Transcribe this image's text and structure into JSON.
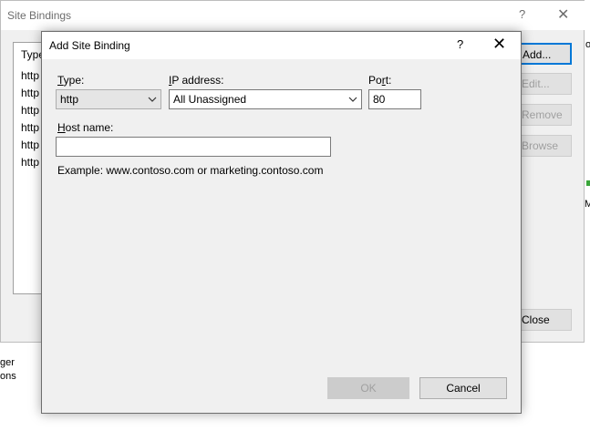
{
  "background_window": {
    "title": "Site Bindings",
    "help_glyph": "?",
    "close_glyph": "✕",
    "list_header": "Type",
    "list_items": [
      "http",
      "http",
      "http",
      "http",
      "http",
      "http"
    ],
    "buttons": {
      "add": "Add...",
      "edit": "Edit...",
      "remove": "Remove",
      "browse": "Browse",
      "close": "Close"
    },
    "side_text_1": "ger",
    "side_text_2": "ons",
    "right_edge_text_1": "o",
    "right_edge_text_2": "M"
  },
  "dialog": {
    "title": "Add Site Binding",
    "help_glyph": "?",
    "close_glyph": "✕",
    "type": {
      "label_accel": "T",
      "label_rest": "ype:",
      "value": "http"
    },
    "ip": {
      "label_accel": "I",
      "label_rest": "P address:",
      "value": "All Unassigned"
    },
    "port": {
      "label_start": "Po",
      "label_accel": "r",
      "label_rest": "t:",
      "value": "80"
    },
    "host": {
      "label_accel": "H",
      "label_rest": "ost name:",
      "value": ""
    },
    "example": "Example: www.contoso.com or marketing.contoso.com",
    "ok_label": "OK",
    "cancel_label": "Cancel"
  },
  "colors": {
    "disabled_text": "#a0a0a0",
    "border": "#7a7a7a",
    "dialog_bg": "#f0f0f0"
  }
}
